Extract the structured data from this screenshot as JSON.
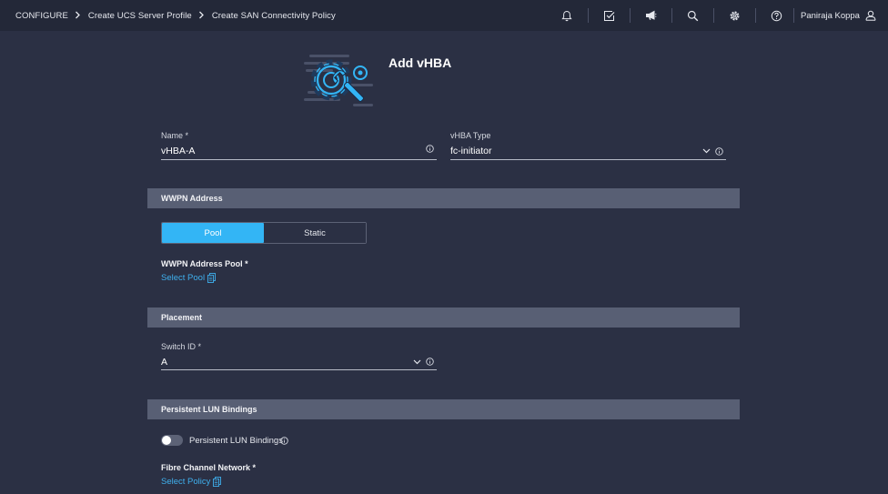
{
  "breadcrumb": [
    "CONFIGURE",
    "Create UCS Server Profile",
    "Create SAN Connectivity Policy"
  ],
  "top_icons": [
    "bell-icon",
    "checklist-icon",
    "megaphone-icon",
    "search-icon",
    "gear-icon",
    "help-icon"
  ],
  "user": {
    "name": "Paniraja Koppa",
    "icon": "user-icon"
  },
  "page_title": "Add vHBA",
  "form": {
    "name": {
      "label": "Name *",
      "value": "vHBA-A"
    },
    "vhba_type": {
      "label": "vHBA Type",
      "value": "fc-initiator"
    }
  },
  "wwpn": {
    "section_title": "WWPN Address",
    "options": [
      "Pool",
      "Static"
    ],
    "selected": "Pool",
    "pool_label": "WWPN Address Pool *",
    "select_pool_link": "Select Pool"
  },
  "placement": {
    "section_title": "Placement",
    "switch_id": {
      "label": "Switch ID *",
      "value": "A"
    }
  },
  "lun": {
    "section_title": "Persistent LUN Bindings",
    "toggle_label": "Persistent LUN Bindings",
    "toggle_on": false,
    "fc_network_label": "Fibre Channel Network *",
    "select_policy_link": "Select Policy"
  },
  "colors": {
    "accent": "#33b5f5",
    "link": "#3fb0ee",
    "background": "#2b3044",
    "topbar": "#232838",
    "section": "#585f74"
  }
}
